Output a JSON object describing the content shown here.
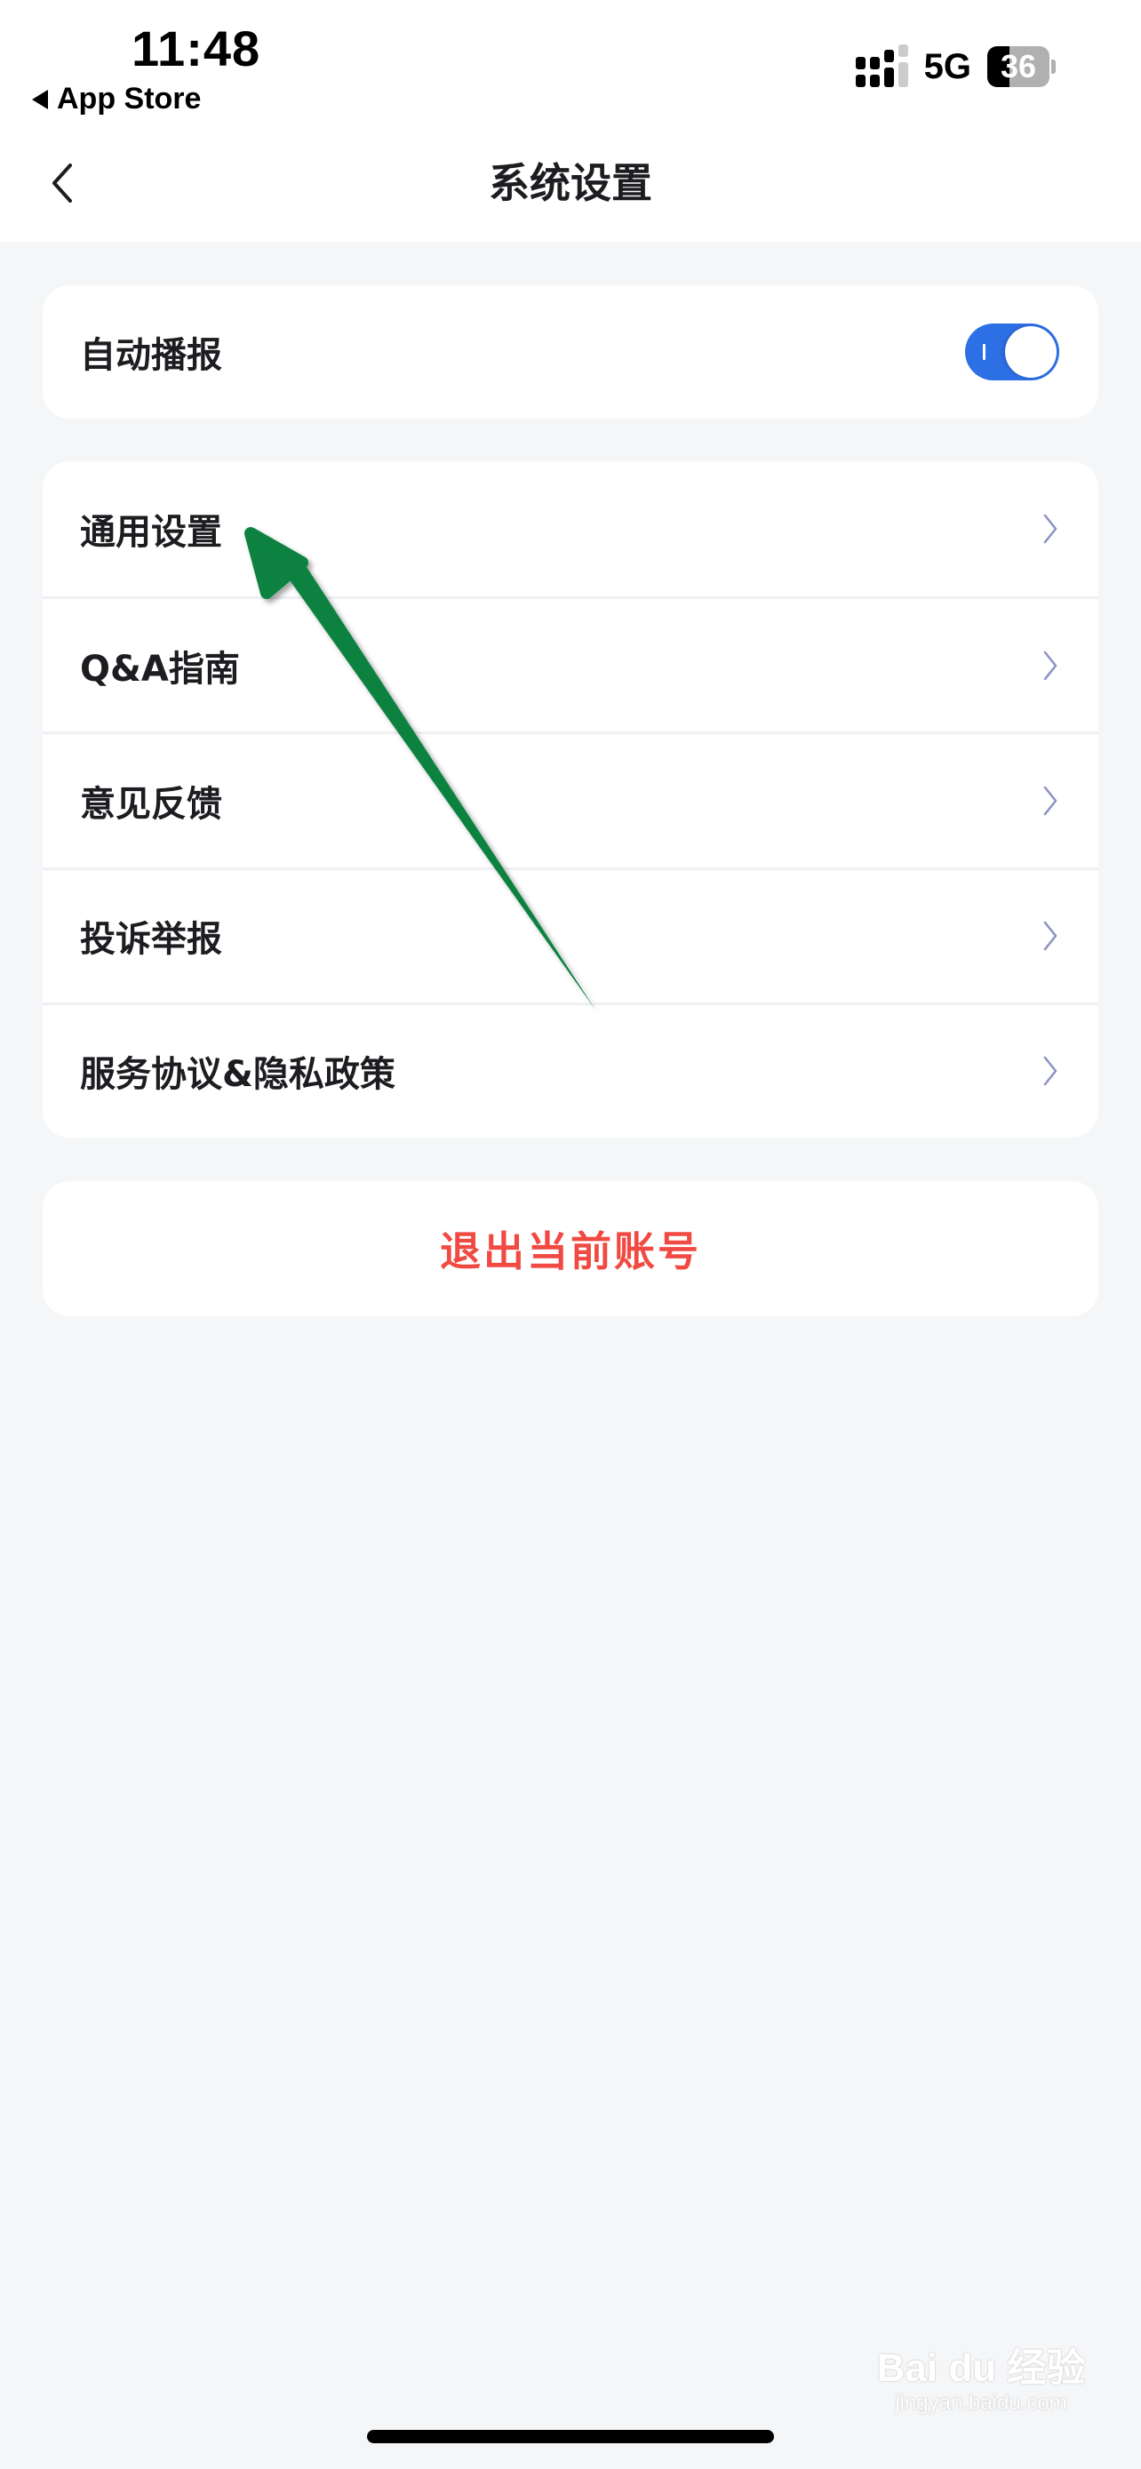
{
  "status_bar": {
    "time": "11:48",
    "back_app": "App Store",
    "network": "5G",
    "battery_percent": 36,
    "signal_bars_active": 3,
    "signal_bars_total": 4
  },
  "nav": {
    "title": "系统设置",
    "back_icon": "chevron-left-icon"
  },
  "toggle_card": {
    "label": "自动播报",
    "enabled": true,
    "accent_color": "#2D6FE5"
  },
  "menu": {
    "items": [
      {
        "label": "通用设置",
        "icon": "chevron-right-icon"
      },
      {
        "label": "Q&A指南",
        "icon": "chevron-right-icon"
      },
      {
        "label": "意见反馈",
        "icon": "chevron-right-icon"
      },
      {
        "label": "投诉举报",
        "icon": "chevron-right-icon"
      },
      {
        "label": "服务协议&隐私政策",
        "icon": "chevron-right-icon"
      }
    ]
  },
  "logout": {
    "label": "退出当前账号",
    "color": "#F04A43"
  },
  "annotation": {
    "type": "arrow",
    "color": "#07823F",
    "points_to": "通用设置"
  },
  "watermark": {
    "brand": "Bai du 经验",
    "url": "jingyan.baidu.com"
  }
}
